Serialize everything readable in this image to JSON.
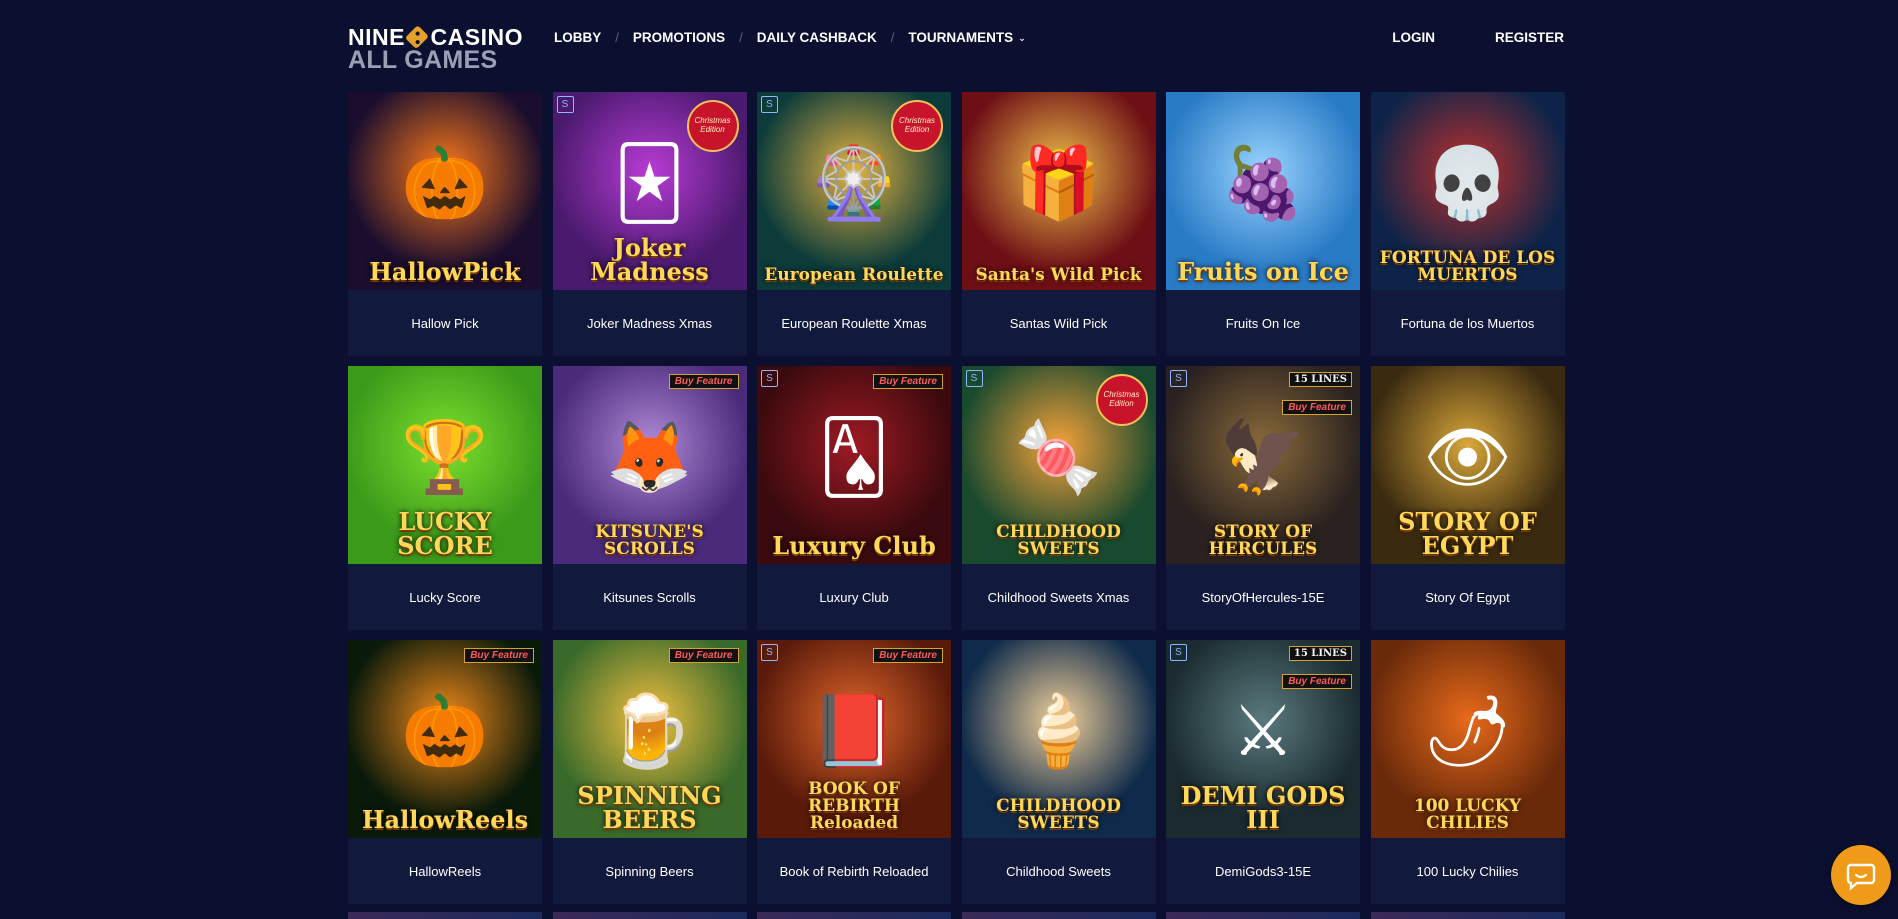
{
  "brand": {
    "line1": "NINE",
    "line2": "CASINO",
    "subtitle": "ALL GAMES"
  },
  "nav": {
    "items": [
      "LOBBY",
      "PROMOTIONS",
      "DAILY CASHBACK",
      "TOURNAMENTS"
    ],
    "separator": "/",
    "tournaments_chevron": "⌄"
  },
  "auth": {
    "login": "LOGIN",
    "register": "REGISTER"
  },
  "games": [
    {
      "title": "Hallow Pick",
      "logo": "HallowPick",
      "icon": "pumpkin",
      "art": "🎃",
      "bg": "#1a0d2e",
      "glow": "#ff7a1a"
    },
    {
      "title": "Joker Madness Xmas",
      "logo": "Joker Madness",
      "icon": "joker",
      "art": "🃏",
      "bg": "#4a1a6e",
      "glow": "#b93bd6",
      "badge_s": "S",
      "badge_xmas": "Christmas Edition"
    },
    {
      "title": "European Roulette Xmas",
      "logo": "European Roulette",
      "icon": "roulette",
      "art": "🎡",
      "bg": "#0c3b3a",
      "glow": "#e3b341",
      "badge_s": "S",
      "badge_xmas": "Christmas Edition"
    },
    {
      "title": "Santas Wild Pick",
      "logo": "Santa's Wild Pick",
      "icon": "candy-cane",
      "art": "🎁",
      "bg": "#6e0f16",
      "glow": "#f1c24a"
    },
    {
      "title": "Fruits On Ice",
      "logo": "Fruits on Ice",
      "icon": "seven",
      "art": "🍇",
      "bg": "#2a7bc6",
      "glow": "#9ad4ff"
    },
    {
      "title": "Fortuna de los Muertos",
      "logo": "FORTUNA DE LOS MUERTOS",
      "icon": "skull",
      "art": "💀",
      "bg": "#0d2448",
      "glow": "#c0312d"
    },
    {
      "title": "Lucky Score",
      "logo": "LUCKY SCORE",
      "icon": "trophy",
      "art": "🏆",
      "bg": "#3c9a1a",
      "glow": "#7de02d"
    },
    {
      "title": "Kitsunes Scrolls",
      "logo": "KITSUNE'S SCROLLS",
      "icon": "fox",
      "art": "🦊",
      "bg": "#4a2a7a",
      "glow": "#b08ad8",
      "badge_buy": "Buy Feature"
    },
    {
      "title": "Luxury Club",
      "logo": "Luxury Club",
      "icon": "cards",
      "art": "🂡",
      "bg": "#3a0a0e",
      "glow": "#9e1a24",
      "badge_s": "S",
      "badge_buy": "Buy Feature"
    },
    {
      "title": "Childhood Sweets Xmas",
      "logo": "CHILDHOOD SWEETS",
      "icon": "sweets",
      "art": "🍬",
      "bg": "#1a4a2e",
      "glow": "#f6a23a",
      "badge_s": "S",
      "badge_xmas": "Christmas Edition"
    },
    {
      "title": "StoryOfHercules-15E",
      "logo": "STORY OF HERCULES",
      "icon": "eagle",
      "art": "🦅",
      "bg": "#2a2220",
      "glow": "#8a6a3a",
      "badge_s": "S",
      "badge_lines": "15 LINES",
      "badge_buy": "Buy Feature"
    },
    {
      "title": "Story Of Egypt",
      "logo": "STORY OF EGYPT",
      "icon": "pharaoh",
      "art": "👁",
      "bg": "#3a2a10",
      "glow": "#d8a63a"
    },
    {
      "title": "HallowReels",
      "logo": "HallowReels",
      "icon": "pumpkin",
      "art": "🎃",
      "bg": "#0a1a0a",
      "glow": "#f28a1a",
      "badge_buy": "Buy Feature"
    },
    {
      "title": "Spinning Beers",
      "logo": "SPINNING BEERS",
      "icon": "beer",
      "art": "🍺",
      "bg": "#3a6a2a",
      "glow": "#f2c040",
      "badge_buy": "Buy Feature"
    },
    {
      "title": "Book of Rebirth Reloaded",
      "logo": "BOOK OF REBIRTH Reloaded",
      "icon": "book",
      "art": "📕",
      "bg": "#5a1a0a",
      "glow": "#e0662a",
      "badge_s": "S",
      "badge_buy": "Buy Feature"
    },
    {
      "title": "Childhood Sweets",
      "logo": "CHILDHOOD SWEETS",
      "icon": "sweets",
      "art": "🍦",
      "bg": "#0f2a4a",
      "glow": "#f0d09a"
    },
    {
      "title": "DemiGods3-15E",
      "logo": "DEMI GODS III",
      "icon": "knight",
      "art": "⚔",
      "bg": "#1a2a2e",
      "glow": "#5a7a7e",
      "badge_s": "S",
      "badge_lines": "15 LINES",
      "badge_buy": "Buy Feature"
    },
    {
      "title": "100 Lucky Chilies",
      "logo": "100 LUCKY CHILIES",
      "icon": "guitar",
      "art": "🌶",
      "bg": "#6a2a0a",
      "glow": "#e86a1a"
    }
  ],
  "chat": {
    "icon": "chat-bubble-icon"
  }
}
